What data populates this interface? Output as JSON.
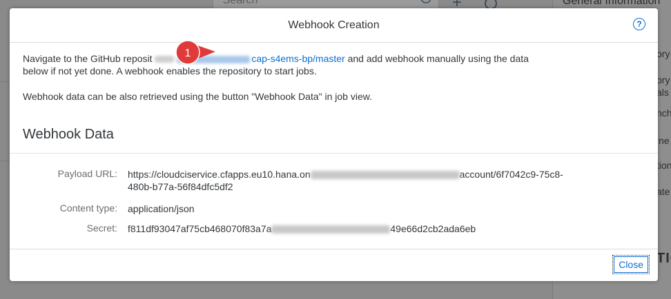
{
  "background": {
    "search_placeholder": "Search",
    "right_panel_title": "General Information",
    "fragments": [
      "ory",
      "ory",
      "als",
      "nch",
      "ine",
      "tion",
      "ate",
      "TIC"
    ]
  },
  "dialog": {
    "title": "Webhook Creation",
    "help_icon": "question-mark-circle-icon",
    "intro_before": "Navigate to the GitHub reposit",
    "intro_link_visible": "cap-s4ems-bp/master",
    "intro_after_link": " and add webhook manually using the data",
    "intro_line2_start": "below if not yet done. A webhook ",
    "intro_line2_end": "enables the repository to start jobs.",
    "hint": "Webhook data can be also retrieved using the button \"Webhook Data\" in job view.",
    "section_title": "Webhook Data",
    "fields": [
      {
        "label": "Payload URL:",
        "value_start": "https://cloudciservice.cfapps.eu10.hana.on",
        "value_end": "account/6f7042c9-75c8-",
        "value_line2": "480b-b77a-56f84dfc5df2"
      },
      {
        "label": "Content type:",
        "value": "application/json"
      },
      {
        "label": "Secret:",
        "value_start": "f811df93047af75cb468070f83a7a",
        "value_end": "49e66d2cb2ada6eb"
      }
    ],
    "close_label": "Close"
  },
  "annotation": {
    "number": "1",
    "color": "#e03a3a"
  },
  "colors": {
    "link": "#0a6ed1",
    "text": "#32363a",
    "label": "#6a6d70"
  }
}
